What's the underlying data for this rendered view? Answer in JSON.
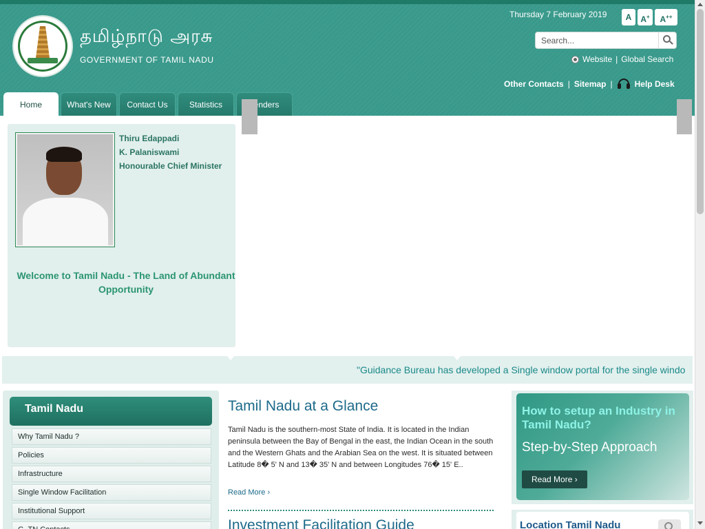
{
  "header": {
    "tamil_title": "தமிழ்நாடு அரசு",
    "english_title": "GOVERNMENT OF TAMIL NADU",
    "date": "Thursday 7 February 2019",
    "font_sizes": [
      "A",
      "A",
      "A"
    ],
    "font_sizes_sup": [
      "",
      "+",
      "++"
    ],
    "search": {
      "placeholder": "Search..."
    },
    "search_scope": {
      "selected": "Website",
      "separator": "|",
      "other": "Global Search"
    },
    "links": [
      "Other Contacts",
      "Sitemap",
      "Help Desk"
    ],
    "separator": "|"
  },
  "nav": {
    "tabs": [
      {
        "label": "Home",
        "active": true
      },
      {
        "label": "What's New"
      },
      {
        "label": "Contact Us"
      },
      {
        "label": "Statistics"
      },
      {
        "label": "Tenders"
      }
    ]
  },
  "chief_minister": {
    "name_line1": "Thiru Edappadi",
    "name_line2": "K. Palaniswami",
    "title": "Honourable Chief Minister"
  },
  "welcome": "Welcome to Tamil Nadu - The Land of Abundant Opportunity",
  "ticker": "\"Guidance Bureau has developed a Single window portal for the single windo",
  "sidebar": {
    "heading": "Tamil Nadu",
    "items": [
      "Why Tamil Nadu ?",
      "Policies",
      "Infrastructure",
      "Single Window Facilitation",
      "Institutional Support",
      "G. TN Contacts"
    ]
  },
  "glance": {
    "title": "Tamil Nadu at a Glance",
    "body": "Tamil Nadu is the southern-most State of India. It is located in the Indian peninsula between the Bay of Bengal in the east, the Indian Ocean in the south and the Western Ghats and the Arabian Sea on the west. It is situated between Latitude 8� 5' N and 13� 35' N and between Longitudes 76� 15' E..",
    "read_more": "Read More ›"
  },
  "guide": {
    "title": "Investment Facilitation Guide"
  },
  "industry": {
    "title": "How to setup an Industry in Tamil Nadu?",
    "subtitle": "Step-by-Step Approach",
    "button": "Read More ›"
  },
  "location": {
    "title": "Location Tamil Nadu"
  },
  "colors": {
    "header_teal": "#39988a",
    "heading_blue": "#1d6a8a",
    "accent_green": "#2b9570"
  }
}
